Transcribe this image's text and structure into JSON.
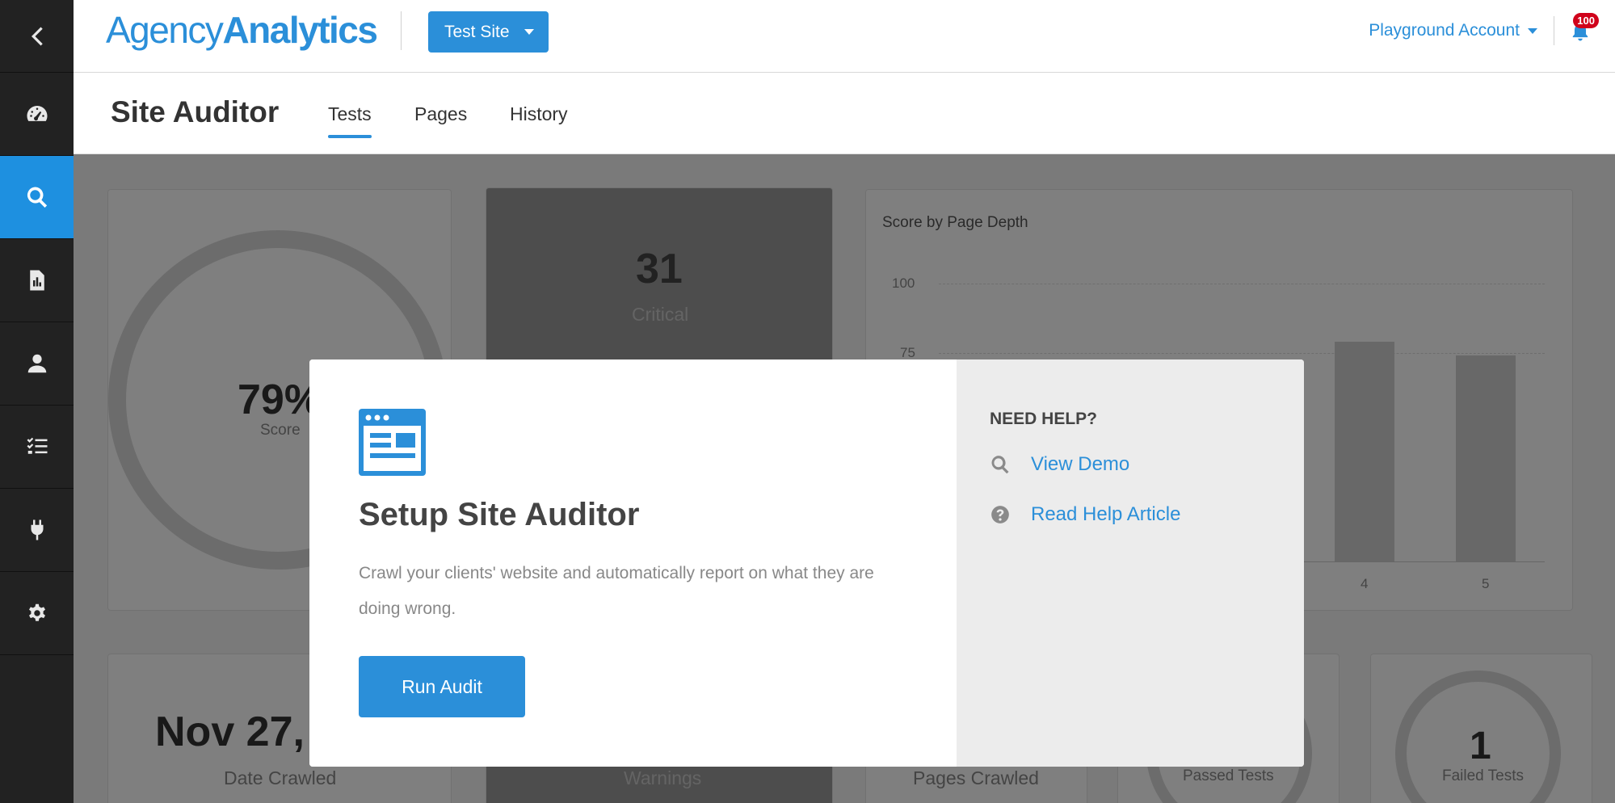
{
  "header": {
    "logo_light": "Agency",
    "logo_bold": "Analytics",
    "site_selector": "Test Site",
    "account": "Playground Account",
    "notification_count": "100"
  },
  "subheader": {
    "title": "Site Auditor",
    "tabs": [
      {
        "label": "Tests",
        "active": true
      },
      {
        "label": "Pages",
        "active": false
      },
      {
        "label": "History",
        "active": false
      }
    ]
  },
  "sidebar": {
    "items": [
      {
        "icon": "chevron-left-icon"
      },
      {
        "icon": "dashboard-gauge-icon"
      },
      {
        "icon": "search-icon",
        "active": true
      },
      {
        "icon": "report-icon"
      },
      {
        "icon": "user-icon"
      },
      {
        "icon": "tasks-icon"
      },
      {
        "icon": "plug-icon"
      },
      {
        "icon": "gear-icon"
      }
    ]
  },
  "dashboard": {
    "score_value": "79%",
    "score_label": "Score",
    "critical_value": "31",
    "critical_label": "Critical",
    "chart_title": "Score by Page Depth",
    "chart_ticks": [
      "100",
      "75"
    ],
    "chart_x_labels": [
      "4",
      "5"
    ],
    "date_value": "Nov 27,",
    "date_label": "Date Crawled",
    "warnings_label": "Warnings",
    "pages_label": "Pages Crawled",
    "passed_label": "Passed Tests",
    "failed_value": "1",
    "failed_label": "Failed Tests"
  },
  "chart_data": {
    "type": "bar",
    "title": "Score by Page Depth",
    "categories": [
      "4",
      "5"
    ],
    "values": [
      79,
      74
    ],
    "ylim": [
      0,
      100
    ]
  },
  "modal": {
    "title": "Setup Site Auditor",
    "description": "Crawl your clients' website and automatically report on what they are doing wrong.",
    "run_button": "Run Audit",
    "help_title": "NEED HELP?",
    "view_demo": "View Demo",
    "help_article": "Read Help Article"
  },
  "colors": {
    "accent": "#2b8fd9",
    "sidebar": "#222222",
    "badge": "#d0021b"
  }
}
